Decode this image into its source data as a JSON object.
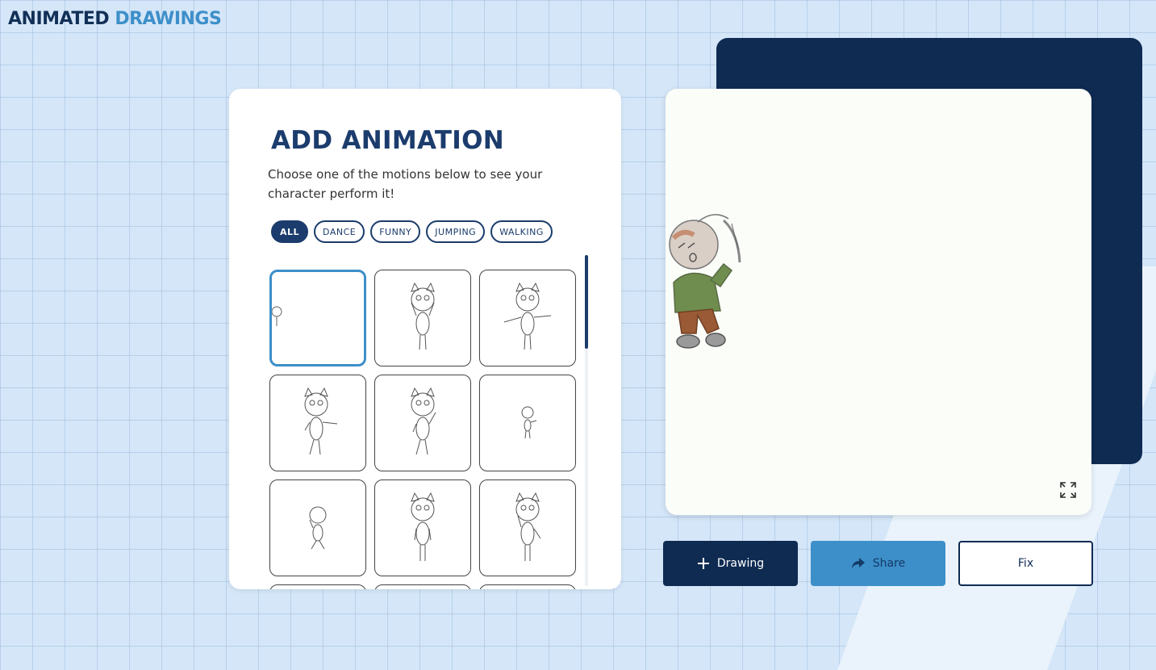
{
  "app": {
    "logo_part1": "ANIMATED",
    "logo_part2": "DRAWINGS"
  },
  "panel": {
    "title": "ADD ANIMATION",
    "description": "Choose one of the motions below to see your character perform it!",
    "filters": [
      {
        "label": "ALL",
        "active": true
      },
      {
        "label": "DANCE",
        "active": false
      },
      {
        "label": "FUNNY",
        "active": false
      },
      {
        "label": "JUMPING",
        "active": false
      },
      {
        "label": "WALKING",
        "active": false
      }
    ],
    "motion_tiles_count": 12,
    "selected_tile": 0
  },
  "actions": {
    "drawing_label": "Drawing",
    "share_label": "Share",
    "fix_label": "Fix"
  },
  "icons": {
    "plus": "plus-icon",
    "share": "share-arrow-icon",
    "expand": "expand-icon"
  },
  "colors": {
    "navy": "#0f2b52",
    "accent": "#3d8fc9",
    "background": "#d4e6f8"
  }
}
